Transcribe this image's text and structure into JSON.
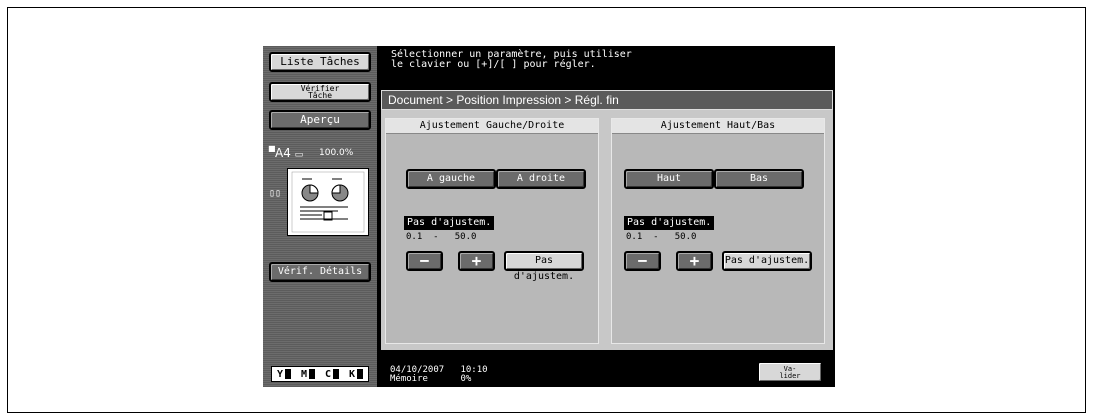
{
  "left": {
    "job_list": "Liste Tâches",
    "verify_job": "Vérifier\nTâche",
    "preview": "Aperçu",
    "paper": "A4",
    "zoom": "100.0%",
    "details": "Vérif. Détails",
    "toner": [
      "Y",
      "M",
      "C",
      "K"
    ]
  },
  "message": "Sélectionner un paramètre, puis utiliser\nle clavier ou [+]/[ ] pour régler.",
  "breadcrumb": "Document > Position Impression > Régl. fin",
  "columns": [
    {
      "title": "Ajustement Gauche/Droite",
      "btn_a": "A gauche",
      "btn_b": "A droite",
      "step_label": "Pas d'ajustem.",
      "range": "0.1  -   50.0",
      "minus": "−",
      "plus": "+",
      "step_btn": "Pas d'ajustem."
    },
    {
      "title": "Ajustement Haut/Bas",
      "btn_a": "Haut",
      "btn_b": "Bas",
      "step_label": "Pas d'ajustem.",
      "range": "0.1  -   50.0",
      "minus": "−",
      "plus": "+",
      "step_btn": "Pas d'ajustem."
    }
  ],
  "footer": {
    "date": "04/10/2007",
    "time": "10:10",
    "memory_label": "Mémoire",
    "memory_value": "0%",
    "validate": "Va-\nlider"
  }
}
